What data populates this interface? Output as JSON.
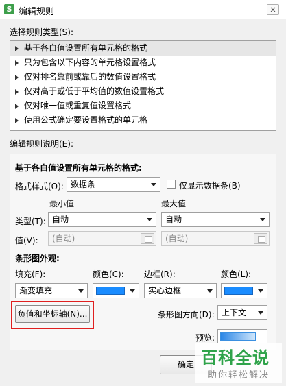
{
  "window": {
    "title": "编辑规则",
    "app_icon_text": "S",
    "close_label": "×"
  },
  "rule_types": {
    "label": "选择规则类型(S):",
    "items": [
      "基于各自值设置所有单元格的格式",
      "只为包含以下内容的单元格设置格式",
      "仅对排名靠前或靠后的数值设置格式",
      "仅对高于或低于平均值的数值设置格式",
      "仅对唯一值或重复值设置格式",
      "使用公式确定要设置格式的单元格"
    ],
    "selected_index": 0
  },
  "description": {
    "label": "编辑规则说明(E):",
    "heading": "基于各自值设置所有单元格的格式:",
    "format_style_label": "格式样式(O):",
    "format_style_value": "数据条",
    "show_bar_only_label": "仅显示数据条(B)",
    "show_bar_only_checked": false,
    "min_label": "最小值",
    "max_label": "最大值",
    "type_label": "类型(T):",
    "min_type": "自动",
    "max_type": "自动",
    "value_label": "值(V):",
    "min_value": "(自动)",
    "max_value": "(自动)",
    "bar_appearance_label": "条形图外观:",
    "fill_label": "填充(F):",
    "fill_value": "渐变填充",
    "fill_color_label": "颜色(C):",
    "fill_color": "#1a8cff",
    "border_label": "边框(R):",
    "border_value": "实心边框",
    "border_color_label": "颜色(L):",
    "border_color": "#1a8cff",
    "negative_axis_button": "负值和坐标轴(N)...",
    "bar_direction_label": "条形图方向(D):",
    "bar_direction_value": "上下文",
    "preview_label": "预览:"
  },
  "footer": {
    "ok_label": "确定"
  },
  "watermark": {
    "main": "百科全说",
    "sub": "助你轻松解决"
  },
  "colors": {
    "highlight_box": "#e02020",
    "watermark_green": "#2fa34a"
  }
}
